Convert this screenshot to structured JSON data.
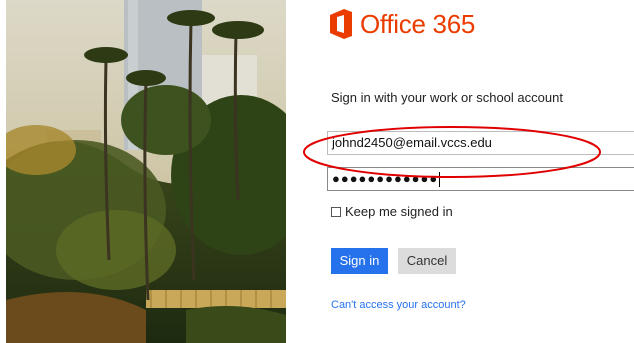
{
  "brand": {
    "name": "Office 365",
    "color": "#eb3c00",
    "logo_icon": "office-logo-icon"
  },
  "signin": {
    "prompt": "Sign in with your work or school account",
    "username_value": "johnd2450@email.vccs.edu",
    "password_mask": "●●●●●●●●●●●●",
    "keep_signed_in_label": "Keep me signed in",
    "keep_signed_in_checked": false,
    "signin_button": "Sign in",
    "cancel_button": "Cancel",
    "help_link": "Can't access your account?",
    "accent_color": "#2672ec"
  },
  "annotation": {
    "shape": "oval",
    "color": "#e00000"
  }
}
